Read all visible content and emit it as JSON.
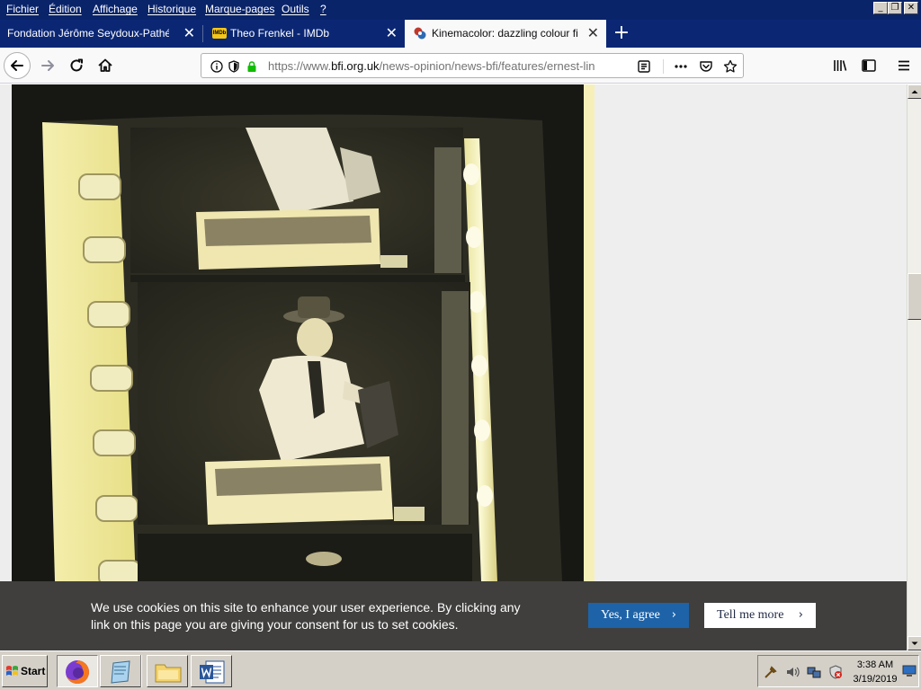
{
  "menubar": {
    "items": [
      "Fichier",
      "Édition",
      "Affichage",
      "Historique",
      "Marque-pages",
      "Outils",
      "?"
    ]
  },
  "window_controls": {
    "minimize": "_",
    "restore": "❐",
    "close": "✕"
  },
  "tabs": [
    {
      "label": "Fondation Jérôme Seydoux-Pathé",
      "close": "✕",
      "active": false
    },
    {
      "label": "Theo Frenkel - IMDb",
      "close": "✕",
      "active": false,
      "favicon": "IMDb"
    },
    {
      "label": "Kinemacolor: dazzling colour film fr",
      "close": "✕",
      "active": true
    }
  ],
  "new_tab": "+",
  "url": {
    "prefix": "https://www.",
    "host": "bfi.org.uk",
    "path": "/news-opinion/news-bfi/features/ernest-lin"
  },
  "cookie": {
    "text": "We use cookies on this site to enhance your user experience. By clicking any link on this page you are giving your consent for us to set cookies.",
    "agree_label": "Yes, I agree",
    "more_label": "Tell me more"
  },
  "taskbar": {
    "start_label": "Start",
    "time": "3:38 AM",
    "date": "3/19/2019"
  },
  "colors": {
    "titlebar": "#0a246a",
    "tabbar": "#0b2774",
    "cookie_bg": "#403f3e",
    "agree_button": "#1e63a8",
    "taskbar": "#d4d0c8"
  },
  "icons": [
    "back-arrow-icon",
    "forward-arrow-icon",
    "reload-icon",
    "home-icon",
    "info-icon",
    "shield-icon",
    "lock-icon",
    "reader-view-icon",
    "more-dots-icon",
    "pocket-icon",
    "star-icon",
    "library-icon",
    "sidebar-icon",
    "hamburger-menu-icon",
    "windows-flag-icon",
    "firefox-icon",
    "notepad-icon",
    "folder-icon",
    "word-icon"
  ]
}
